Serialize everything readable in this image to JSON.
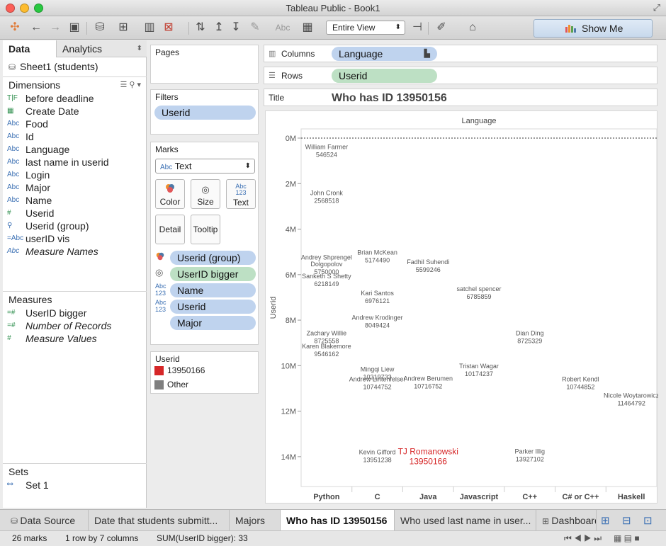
{
  "window": {
    "title": "Tableau Public - Book1"
  },
  "toolbar": {
    "fit_select": "Entire View",
    "show_me": "Show Me",
    "format_label": "Abc"
  },
  "data_pane": {
    "tabs": [
      "Data",
      "Analytics"
    ],
    "datasource": "Sheet1 (students)",
    "dimensions_header": "Dimensions",
    "dimensions": [
      {
        "type": "T|F",
        "name": "before deadline"
      },
      {
        "type": "date",
        "name": "Create Date"
      },
      {
        "type": "Abc",
        "name": "Food"
      },
      {
        "type": "Abc",
        "name": "Id"
      },
      {
        "type": "Abc",
        "name": "Language"
      },
      {
        "type": "Abc",
        "name": "last name in userid"
      },
      {
        "type": "Abc",
        "name": "Login"
      },
      {
        "type": "Abc",
        "name": "Major"
      },
      {
        "type": "Abc",
        "name": "Name"
      },
      {
        "type": "#",
        "name": "Userid"
      },
      {
        "type": "clip",
        "name": "Userid (group)"
      },
      {
        "type": "=Abc",
        "name": "userID vis"
      },
      {
        "type": "Abc",
        "name": "Measure Names"
      }
    ],
    "measures_header": "Measures",
    "measures": [
      {
        "type": "=#",
        "name": "UserID bigger"
      },
      {
        "type": "=#",
        "name": "Number of Records"
      },
      {
        "type": "#",
        "name": "Measure Values"
      }
    ],
    "sets_header": "Sets",
    "sets": [
      {
        "name": "Set 1"
      }
    ]
  },
  "cards": {
    "pages": "Pages",
    "filters": "Filters",
    "filter_pill": "Userid",
    "marks": "Marks",
    "mark_type": "Text",
    "mark_type_icon": "Abc",
    "buttons": {
      "color": "Color",
      "size": "Size",
      "text": "Text",
      "detail": "Detail",
      "tooltip": "Tooltip"
    },
    "text_button_icon": [
      "Abc",
      "123"
    ],
    "encodings": [
      "Userid (group)",
      "UserID bigger",
      "Name",
      "Userid",
      "Major"
    ],
    "legend_title": "Userid",
    "legend_items": [
      {
        "label": "13950166",
        "color": "#d62728"
      },
      {
        "label": "Other",
        "color": "#7f7f7f"
      }
    ]
  },
  "shelves": {
    "columns_label": "Columns",
    "columns_pill": "Language",
    "rows_label": "Rows",
    "rows_pill": "Userid",
    "title_label": "Title",
    "title_value": "Who has ID 13950156"
  },
  "chart_data": {
    "type": "text-table",
    "title": "Language",
    "xlabel": "",
    "ylabel": "Userid",
    "categories": [
      "Python",
      "C",
      "Java",
      "Javascript",
      "C++",
      "C# or C++",
      "Haskell"
    ],
    "y_ticks": [
      "0M",
      "2M",
      "4M",
      "6M",
      "8M",
      "10M",
      "12M",
      "14M"
    ],
    "ylim": [
      0,
      15000000
    ],
    "reference_line_y": 0,
    "highlight_color": "#d62728",
    "mark_color": "#555555",
    "marks": [
      {
        "col": "Python",
        "y": 546524,
        "name": "William Farmer",
        "id": "546524"
      },
      {
        "col": "Python",
        "y": 2568518,
        "name": "John Cronk",
        "id": "2568518"
      },
      {
        "col": "Python",
        "y": 5400000,
        "name": "Andrey Shprengel",
        "id": ""
      },
      {
        "col": "Python",
        "y": 5700000,
        "name": "Dolgopolov",
        "id": "5750000"
      },
      {
        "col": "Python",
        "y": 6218149,
        "name": "Sanketh S Shetty",
        "id": "6218149"
      },
      {
        "col": "Python",
        "y": 8725558,
        "name": "Zachary Willie",
        "id": "8725558"
      },
      {
        "col": "Python",
        "y": 9300000,
        "name": "Karen Blakemore",
        "id": "9546162"
      },
      {
        "col": "C",
        "y": 5174490,
        "name": "Brian McKean",
        "id": "5174490"
      },
      {
        "col": "C",
        "y": 6976121,
        "name": "Kari Santos",
        "id": "6976121"
      },
      {
        "col": "C",
        "y": 8049424,
        "name": "Andrew Krodinger",
        "id": "8049424"
      },
      {
        "col": "C",
        "y": 10319733,
        "name": "Mingqi Liew",
        "id": "10319733"
      },
      {
        "col": "C",
        "y": 10744752,
        "name": "Andrew Lintenfelser",
        "id": "10744752"
      },
      {
        "col": "C",
        "y": 13951238,
        "name": "Kevin Gifford",
        "id": "13951238"
      },
      {
        "col": "Java",
        "y": 5599246,
        "name": "Fadhil Suhendi",
        "id": "5599246"
      },
      {
        "col": "Java",
        "y": 10716752,
        "name": "Andrew Berumen",
        "id": "10716752"
      },
      {
        "col": "Java",
        "y": 13950166,
        "name": "TJ Romanowski",
        "id": "13950166",
        "highlight": true
      },
      {
        "col": "Javascript",
        "y": 6785859,
        "name": "satchel spencer",
        "id": "6785859"
      },
      {
        "col": "Javascript",
        "y": 10174237,
        "name": "Tristan Wagar",
        "id": "10174237"
      },
      {
        "col": "C++",
        "y": 8725329,
        "name": "Dian Ding",
        "id": "8725329"
      },
      {
        "col": "C++",
        "y": 13927102,
        "name": "Parker Illig",
        "id": "13927102"
      },
      {
        "col": "C# or C++",
        "y": 10744852,
        "name": "Robert Kendl",
        "id": "10744852"
      },
      {
        "col": "Haskell",
        "y": 11464792,
        "name": "Nicole Woytarowicz",
        "id": "11464792"
      }
    ]
  },
  "sheet_tabs": [
    {
      "label": "Data Source",
      "active": false
    },
    {
      "label": "Date that students submitt...",
      "active": false
    },
    {
      "label": "Majors",
      "active": false
    },
    {
      "label": "Who has ID 13950156",
      "active": true
    },
    {
      "label": "Who used last name in user...",
      "active": false
    },
    {
      "label": "Dashboard",
      "active": false
    }
  ],
  "status": {
    "marks": "26 marks",
    "layout": "1 row by 7 columns",
    "sum": "SUM(UserID bigger): 33"
  }
}
